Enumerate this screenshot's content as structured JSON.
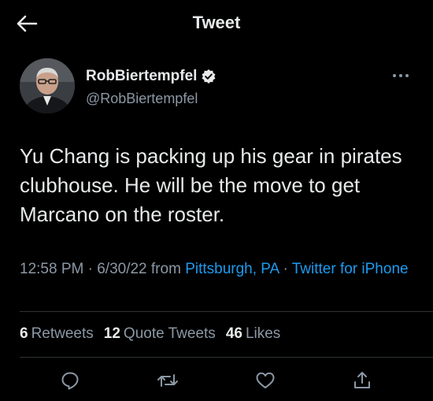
{
  "header": {
    "title": "Tweet"
  },
  "user": {
    "display_name": "RobBiertempfel",
    "handle": "@RobBiertempfel",
    "verified": true
  },
  "tweet": {
    "text": "Yu Chang is packing up his gear in pirates clubhouse. He will be the move to get Marcano on the roster.",
    "time": "12:58 PM",
    "date": "6/30/22",
    "from_label": "from",
    "location": "Pittsburgh, PA",
    "client": "Twitter for iPhone"
  },
  "stats": {
    "retweets_count": "6",
    "retweets_label": "Retweets",
    "quotes_count": "12",
    "quotes_label": "Quote Tweets",
    "likes_count": "46",
    "likes_label": "Likes"
  },
  "colors": {
    "background": "#000000",
    "text": "#e7e9ea",
    "secondary": "#8b98a5",
    "accent": "#1d9bf0",
    "divider": "#2f3336"
  },
  "icons": [
    "back-arrow-icon",
    "verified-badge-icon",
    "more-icon",
    "reply-icon",
    "retweet-icon",
    "like-icon",
    "share-icon"
  ]
}
